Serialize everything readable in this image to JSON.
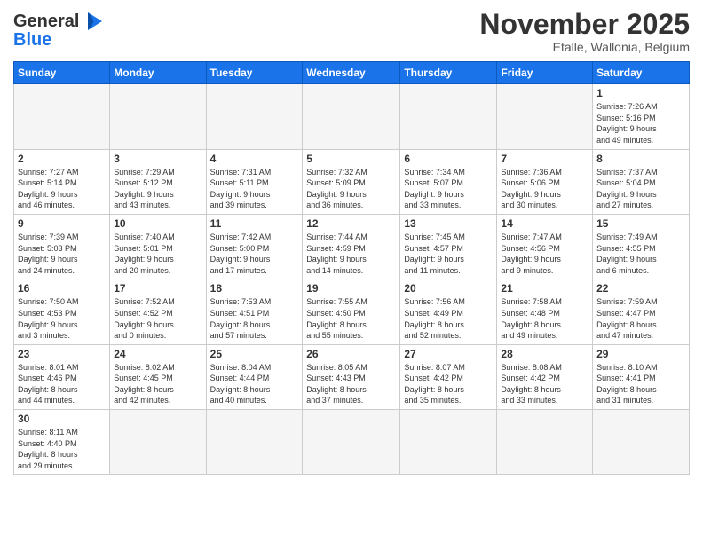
{
  "header": {
    "logo": {
      "line1": "General",
      "line2": "Blue"
    },
    "title": "November 2025",
    "subtitle": "Etalle, Wallonia, Belgium"
  },
  "weekdays": [
    "Sunday",
    "Monday",
    "Tuesday",
    "Wednesday",
    "Thursday",
    "Friday",
    "Saturday"
  ],
  "weeks": [
    [
      {
        "day": "",
        "info": ""
      },
      {
        "day": "",
        "info": ""
      },
      {
        "day": "",
        "info": ""
      },
      {
        "day": "",
        "info": ""
      },
      {
        "day": "",
        "info": ""
      },
      {
        "day": "",
        "info": ""
      },
      {
        "day": "1",
        "info": "Sunrise: 7:26 AM\nSunset: 5:16 PM\nDaylight: 9 hours\nand 49 minutes."
      }
    ],
    [
      {
        "day": "2",
        "info": "Sunrise: 7:27 AM\nSunset: 5:14 PM\nDaylight: 9 hours\nand 46 minutes."
      },
      {
        "day": "3",
        "info": "Sunrise: 7:29 AM\nSunset: 5:12 PM\nDaylight: 9 hours\nand 43 minutes."
      },
      {
        "day": "4",
        "info": "Sunrise: 7:31 AM\nSunset: 5:11 PM\nDaylight: 9 hours\nand 39 minutes."
      },
      {
        "day": "5",
        "info": "Sunrise: 7:32 AM\nSunset: 5:09 PM\nDaylight: 9 hours\nand 36 minutes."
      },
      {
        "day": "6",
        "info": "Sunrise: 7:34 AM\nSunset: 5:07 PM\nDaylight: 9 hours\nand 33 minutes."
      },
      {
        "day": "7",
        "info": "Sunrise: 7:36 AM\nSunset: 5:06 PM\nDaylight: 9 hours\nand 30 minutes."
      },
      {
        "day": "8",
        "info": "Sunrise: 7:37 AM\nSunset: 5:04 PM\nDaylight: 9 hours\nand 27 minutes."
      }
    ],
    [
      {
        "day": "9",
        "info": "Sunrise: 7:39 AM\nSunset: 5:03 PM\nDaylight: 9 hours\nand 24 minutes."
      },
      {
        "day": "10",
        "info": "Sunrise: 7:40 AM\nSunset: 5:01 PM\nDaylight: 9 hours\nand 20 minutes."
      },
      {
        "day": "11",
        "info": "Sunrise: 7:42 AM\nSunset: 5:00 PM\nDaylight: 9 hours\nand 17 minutes."
      },
      {
        "day": "12",
        "info": "Sunrise: 7:44 AM\nSunset: 4:59 PM\nDaylight: 9 hours\nand 14 minutes."
      },
      {
        "day": "13",
        "info": "Sunrise: 7:45 AM\nSunset: 4:57 PM\nDaylight: 9 hours\nand 11 minutes."
      },
      {
        "day": "14",
        "info": "Sunrise: 7:47 AM\nSunset: 4:56 PM\nDaylight: 9 hours\nand 9 minutes."
      },
      {
        "day": "15",
        "info": "Sunrise: 7:49 AM\nSunset: 4:55 PM\nDaylight: 9 hours\nand 6 minutes."
      }
    ],
    [
      {
        "day": "16",
        "info": "Sunrise: 7:50 AM\nSunset: 4:53 PM\nDaylight: 9 hours\nand 3 minutes."
      },
      {
        "day": "17",
        "info": "Sunrise: 7:52 AM\nSunset: 4:52 PM\nDaylight: 9 hours\nand 0 minutes."
      },
      {
        "day": "18",
        "info": "Sunrise: 7:53 AM\nSunset: 4:51 PM\nDaylight: 8 hours\nand 57 minutes."
      },
      {
        "day": "19",
        "info": "Sunrise: 7:55 AM\nSunset: 4:50 PM\nDaylight: 8 hours\nand 55 minutes."
      },
      {
        "day": "20",
        "info": "Sunrise: 7:56 AM\nSunset: 4:49 PM\nDaylight: 8 hours\nand 52 minutes."
      },
      {
        "day": "21",
        "info": "Sunrise: 7:58 AM\nSunset: 4:48 PM\nDaylight: 8 hours\nand 49 minutes."
      },
      {
        "day": "22",
        "info": "Sunrise: 7:59 AM\nSunset: 4:47 PM\nDaylight: 8 hours\nand 47 minutes."
      }
    ],
    [
      {
        "day": "23",
        "info": "Sunrise: 8:01 AM\nSunset: 4:46 PM\nDaylight: 8 hours\nand 44 minutes."
      },
      {
        "day": "24",
        "info": "Sunrise: 8:02 AM\nSunset: 4:45 PM\nDaylight: 8 hours\nand 42 minutes."
      },
      {
        "day": "25",
        "info": "Sunrise: 8:04 AM\nSunset: 4:44 PM\nDaylight: 8 hours\nand 40 minutes."
      },
      {
        "day": "26",
        "info": "Sunrise: 8:05 AM\nSunset: 4:43 PM\nDaylight: 8 hours\nand 37 minutes."
      },
      {
        "day": "27",
        "info": "Sunrise: 8:07 AM\nSunset: 4:42 PM\nDaylight: 8 hours\nand 35 minutes."
      },
      {
        "day": "28",
        "info": "Sunrise: 8:08 AM\nSunset: 4:42 PM\nDaylight: 8 hours\nand 33 minutes."
      },
      {
        "day": "29",
        "info": "Sunrise: 8:10 AM\nSunset: 4:41 PM\nDaylight: 8 hours\nand 31 minutes."
      }
    ],
    [
      {
        "day": "30",
        "info": "Sunrise: 8:11 AM\nSunset: 4:40 PM\nDaylight: 8 hours\nand 29 minutes."
      },
      {
        "day": "",
        "info": ""
      },
      {
        "day": "",
        "info": ""
      },
      {
        "day": "",
        "info": ""
      },
      {
        "day": "",
        "info": ""
      },
      {
        "day": "",
        "info": ""
      },
      {
        "day": "",
        "info": ""
      }
    ]
  ]
}
